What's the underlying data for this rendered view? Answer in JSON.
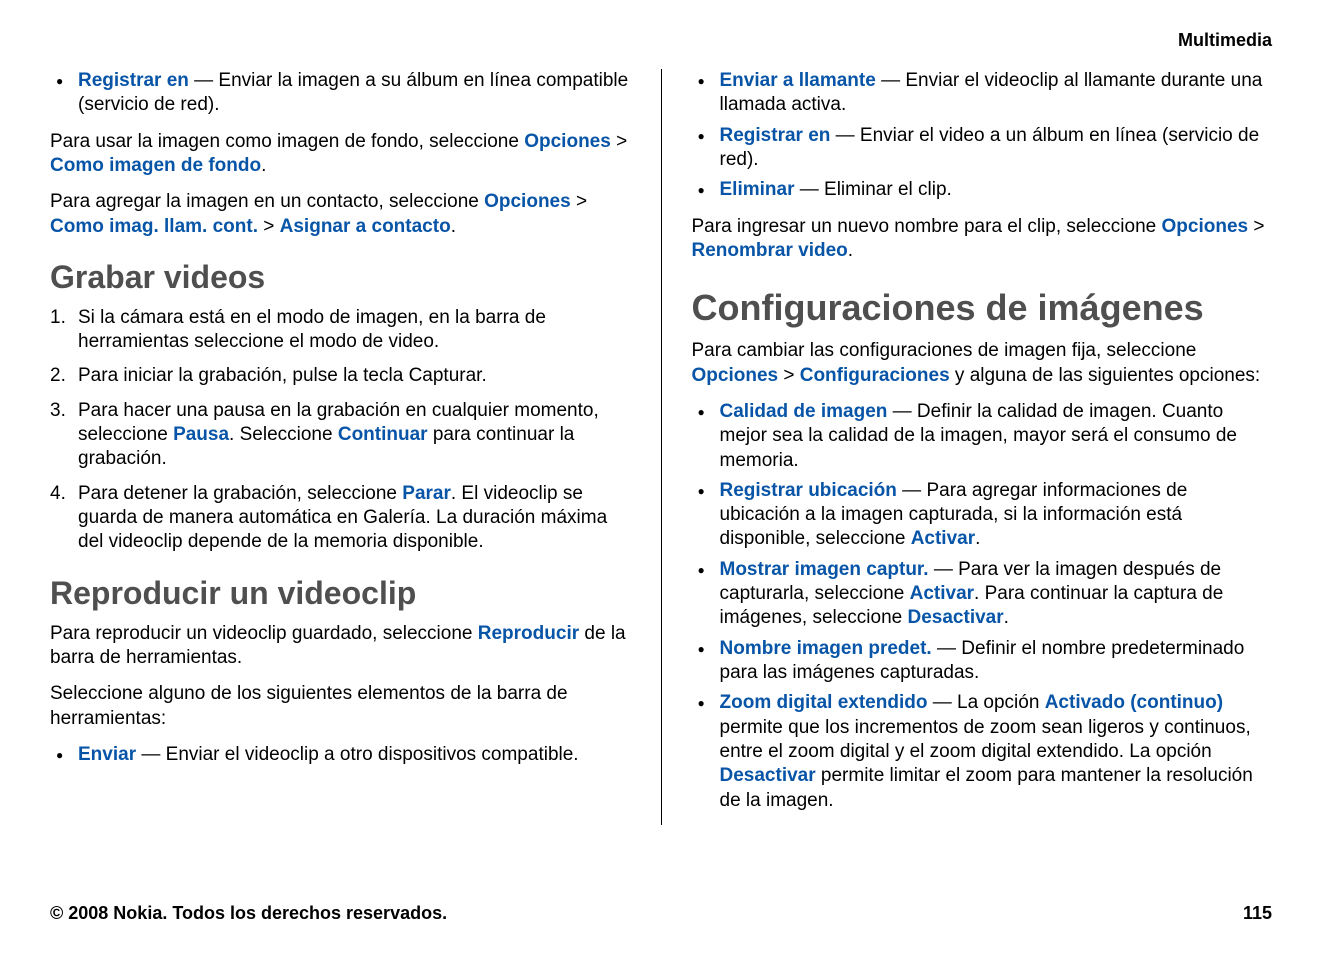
{
  "header": {
    "title": "Multimedia"
  },
  "left": {
    "intro_bullet": {
      "term": "Registrar en",
      "desc": " — Enviar la imagen a su álbum en línea compatible (servicio de red)."
    },
    "p1": {
      "pre": "Para usar la imagen como imagen de fondo, seleccione ",
      "opt": "Opciones",
      "sep": " > ",
      "cmd": "Como imagen de fondo",
      "post": "."
    },
    "p2": {
      "pre": "Para agregar la imagen en un contacto, seleccione ",
      "opt": "Opciones",
      "sep1": " > ",
      "cmd1": "Como imag. llam. cont.",
      "sep2": " > ",
      "cmd2": "Asignar a contacto",
      "post": "."
    },
    "h_grabar": "Grabar videos",
    "steps": [
      "Si la cámara está en el modo de imagen, en la barra de herramientas seleccione el modo de video.",
      "Para iniciar la grabación, pulse la tecla Capturar."
    ],
    "step3": {
      "pre": "Para hacer una pausa en la grabación en cualquier momento, seleccione ",
      "kw1": "Pausa",
      "mid": ". Seleccione ",
      "kw2": "Continuar",
      "post": " para continuar la grabación."
    },
    "step4": {
      "pre": "Para detener la grabación, seleccione ",
      "kw": "Parar",
      "post": ". El videoclip se guarda de manera automática en Galería. La duración máxima del videoclip depende de la memoria disponible."
    },
    "h_repro": "Reproducir un videoclip",
    "p3": {
      "pre": "Para reproducir un videoclip guardado, seleccione ",
      "kw": "Reproducir",
      "post": " de la barra de herramientas."
    },
    "p4": "Seleccione alguno de los siguientes elementos de la barra de herramientas:",
    "bl2": {
      "term": "Enviar",
      "desc": " — Enviar el videoclip a otro dispositivos compatible."
    }
  },
  "right": {
    "bullets": [
      {
        "term": "Enviar a llamante",
        "desc": " — Enviar el videoclip al llamante durante una llamada activa."
      },
      {
        "term": "Registrar en",
        "desc": " — Enviar el video a un álbum en línea (servicio de red)."
      },
      {
        "term": "Eliminar",
        "desc": " — Eliminar el clip."
      }
    ],
    "p1": {
      "pre": "Para ingresar un nuevo nombre para el clip, seleccione ",
      "opt": "Opciones",
      "sep": " > ",
      "cmd": "Renombrar video",
      "post": "."
    },
    "h_config": "Configuraciones de imágenes",
    "p2": {
      "pre": "Para cambiar las configuraciones de imagen fija, seleccione ",
      "opt": "Opciones",
      "sep": " > ",
      "cmd": "Configuraciones",
      "post": " y alguna de las siguientes opciones:"
    },
    "cfg": {
      "calidad": {
        "term": "Calidad de imagen",
        "desc": " — Definir la calidad de imagen. Cuanto mejor sea la calidad de la imagen, mayor será el consumo de memoria."
      },
      "ubic": {
        "term": "Registrar ubicación",
        "pre": " — Para agregar informaciones de ubicación a la imagen capturada, si la información está disponible, seleccione ",
        "kw": "Activar",
        "post": "."
      },
      "mostrar": {
        "term": "Mostrar imagen captur.",
        "pre": " — Para ver la imagen después de capturarla, seleccione ",
        "kw1": "Activar",
        "mid": ". Para continuar la captura de imágenes, seleccione ",
        "kw2": "Desactivar",
        "post": "."
      },
      "nombre": {
        "term": "Nombre imagen predet.",
        "desc": " — Definir el nombre predeterminado para las imágenes capturadas."
      },
      "zoom": {
        "term": "Zoom digital extendido",
        "pre": " — La opción ",
        "kw1": "Activado (continuo)",
        "mid": " permite que los incrementos de zoom sean ligeros y continuos, entre el zoom digital y el zoom digital extendido. La opción ",
        "kw2": "Desactivar",
        "post": " permite limitar el zoom para mantener la resolución de la imagen."
      }
    }
  },
  "footer": {
    "copyright": "© 2008 Nokia. Todos los derechos reservados.",
    "page": "115"
  }
}
